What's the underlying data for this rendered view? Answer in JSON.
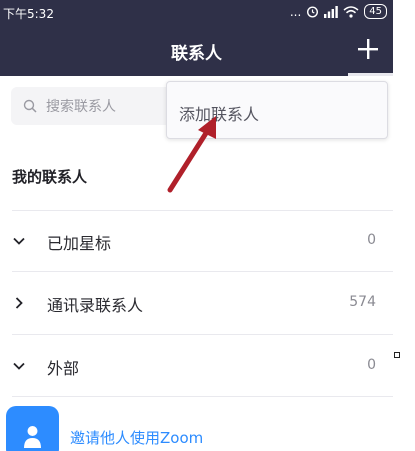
{
  "status_bar": {
    "time": "下午5:32",
    "dots": "...",
    "battery": "45"
  },
  "nav": {
    "title": "联系人",
    "add_icon": "plus-icon"
  },
  "search": {
    "placeholder": "搜索联系人"
  },
  "dropdown": {
    "items": [
      {
        "label": "添加联系人"
      }
    ]
  },
  "section": {
    "title": "我的联系人"
  },
  "groups": [
    {
      "label": "已加星标",
      "count": "0",
      "state": "expanded"
    },
    {
      "label": "通讯录联系人",
      "count": "574",
      "state": "collapsed"
    },
    {
      "label": "外部",
      "count": "0",
      "state": "expanded"
    }
  ],
  "invite": {
    "label": "邀请他人使用Zoom"
  },
  "colors": {
    "header_bg": "#2f3048",
    "accent": "#2d8cff",
    "annotation_arrow": "#b0202a"
  }
}
